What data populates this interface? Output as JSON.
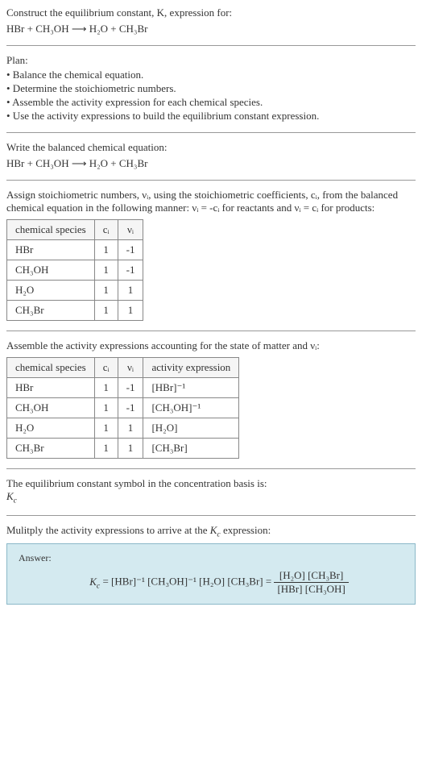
{
  "header": {
    "title_line1": "Construct the equilibrium constant, K, expression for:",
    "equation": "HBr + CH₃OH  ⟶  H₂O + CH₃Br"
  },
  "plan": {
    "label": "Plan:",
    "items": [
      "• Balance the chemical equation.",
      "• Determine the stoichiometric numbers.",
      "• Assemble the activity expression for each chemical species.",
      "• Use the activity expressions to build the equilibrium constant expression."
    ]
  },
  "balanced": {
    "label": "Write the balanced chemical equation:",
    "equation": "HBr + CH₃OH  ⟶  H₂O + CH₃Br"
  },
  "stoich": {
    "intro_a": "Assign stoichiometric numbers, νᵢ, using the stoichiometric coefficients, cᵢ, from the balanced chemical equation in the following manner: νᵢ = -cᵢ for reactants and νᵢ = cᵢ for products:",
    "table": {
      "headers": [
        "chemical species",
        "cᵢ",
        "νᵢ"
      ],
      "rows": [
        {
          "species": "HBr",
          "c": "1",
          "v": "-1"
        },
        {
          "species": "CH₃OH",
          "c": "1",
          "v": "-1"
        },
        {
          "species": "H₂O",
          "c": "1",
          "v": "1"
        },
        {
          "species": "CH₃Br",
          "c": "1",
          "v": "1"
        }
      ]
    }
  },
  "activity": {
    "intro": "Assemble the activity expressions accounting for the state of matter and νᵢ:",
    "table": {
      "headers": [
        "chemical species",
        "cᵢ",
        "νᵢ",
        "activity expression"
      ],
      "rows": [
        {
          "species": "HBr",
          "c": "1",
          "v": "-1",
          "expr": "[HBr]⁻¹"
        },
        {
          "species": "CH₃OH",
          "c": "1",
          "v": "-1",
          "expr": "[CH₃OH]⁻¹"
        },
        {
          "species": "H₂O",
          "c": "1",
          "v": "1",
          "expr": "[H₂O]"
        },
        {
          "species": "CH₃Br",
          "c": "1",
          "v": "1",
          "expr": "[CH₃Br]"
        }
      ]
    }
  },
  "kc_symbol": {
    "line1": "The equilibrium constant symbol in the concentration basis is:",
    "line2": "K_c"
  },
  "multiply": {
    "text": "Mulitply the activity expressions to arrive at the K_c expression:"
  },
  "answer": {
    "label": "Answer:",
    "lhs": "K_c = [HBr]⁻¹ [CH₃OH]⁻¹ [H₂O] [CH₃Br] = ",
    "frac_num": "[H₂O] [CH₃Br]",
    "frac_den": "[HBr] [CH₃OH]"
  }
}
